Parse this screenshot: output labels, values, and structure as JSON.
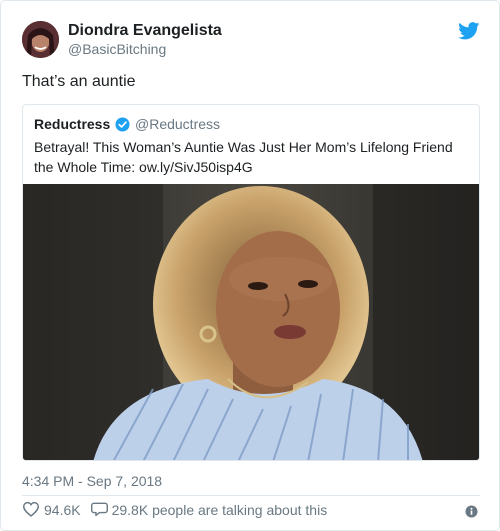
{
  "tweet": {
    "author_name": "Diondra Evangelista",
    "author_handle": "@BasicBitching",
    "text": "That’s an auntie",
    "timestamp": "4:34 PM - Sep 7, 2018",
    "likes": "94.6K",
    "talking": "29.8K people are talking about this"
  },
  "quoted": {
    "author_name": "Reductress",
    "author_handle": "@Reductress",
    "text": "Betrayal! This Woman’s Auntie Was Just Her Mom’s Lifelong Friend the Whole Time: ow.ly/SivJ50isp4G"
  },
  "colors": {
    "twitter_blue": "#1da1f2",
    "secondary_text": "#697882",
    "border": "#e1e8ed"
  },
  "icons": {
    "bird": "twitter-bird-icon",
    "verified": "verified-badge-icon",
    "like": "heart-icon",
    "reply": "speech-bubble-icon",
    "info": "info-icon"
  }
}
